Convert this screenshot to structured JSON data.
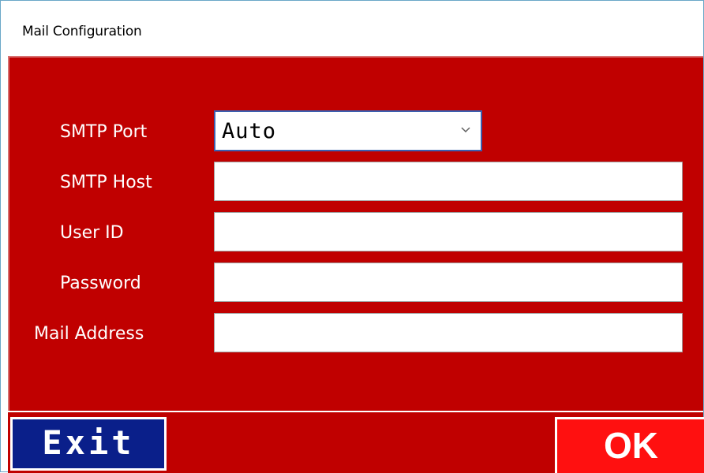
{
  "window": {
    "title": "Mail Configuration"
  },
  "form": {
    "smtp_port": {
      "label": "SMTP Port",
      "value": "Auto"
    },
    "smtp_host": {
      "label": "SMTP Host",
      "value": ""
    },
    "user_id": {
      "label": "User ID",
      "value": ""
    },
    "password": {
      "label": "Password",
      "value": ""
    },
    "mail_address": {
      "label": "Mail Address",
      "value": ""
    }
  },
  "buttons": {
    "exit": "Exit",
    "ok": "OK"
  },
  "icons": {
    "dropdown": "chevron-down-icon"
  },
  "colors": {
    "panel_red": "#c00000",
    "exit_blue": "#0a1f8a",
    "ok_red": "#ff1010",
    "combo_border": "#3b5fb0"
  }
}
